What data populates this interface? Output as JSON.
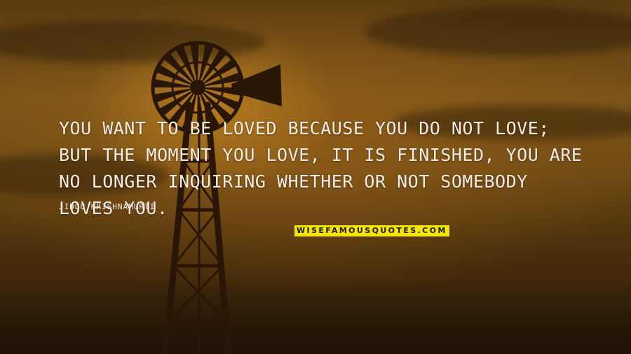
{
  "quote": {
    "text": "YOU WANT TO BE LOVED BECAUSE YOU DO NOT LOVE; BUT THE MOMENT YOU LOVE, IT IS FINISHED, YOU ARE NO LONGER INQUIRING WHETHER OR NOT SOMEBODY LOVES YOU.",
    "author": "JIDDU KRISHNAMURTI"
  },
  "watermark": {
    "text": "WISEFAMOUSQUOTES.COM"
  },
  "colors": {
    "text": "#f3ede4",
    "watermark_bg": "#f4e40a",
    "sky": "#7a5418",
    "silhouette": "#2a1606"
  },
  "scene": {
    "subject": "windmill-silhouette",
    "lighting": "sunset"
  }
}
